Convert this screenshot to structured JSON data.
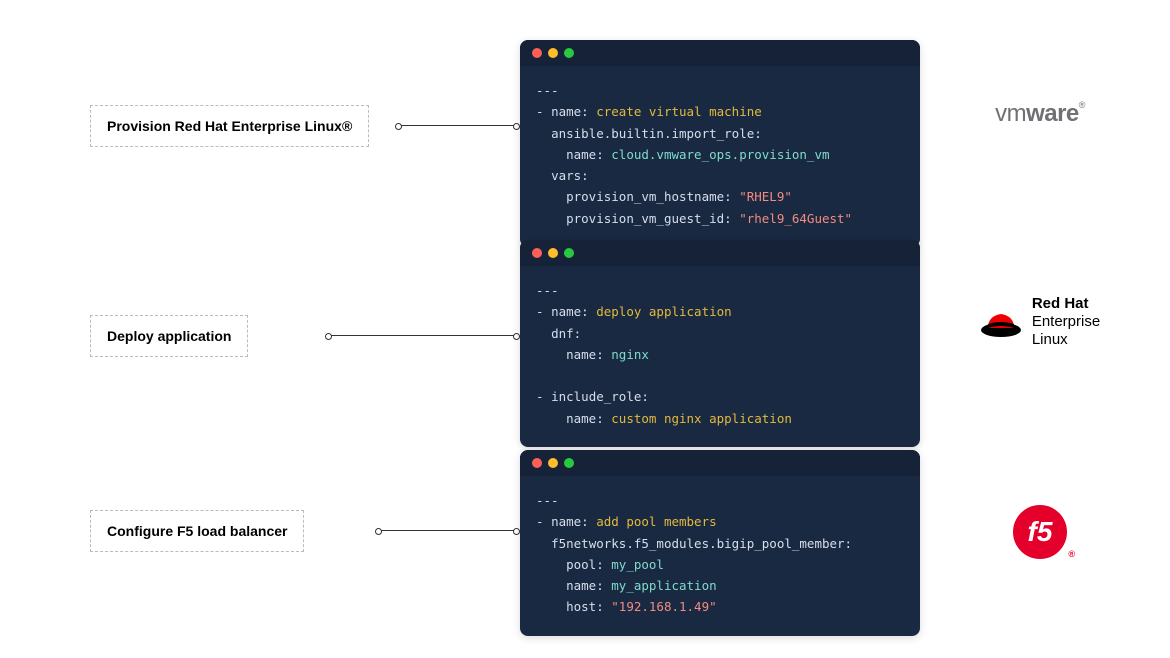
{
  "rows": [
    {
      "label": "Provision Red Hat Enterprise Linux®",
      "logo": "vmware",
      "code": {
        "lines": [
          [
            {
              "c": "t-plain",
              "t": "---"
            }
          ],
          [
            {
              "c": "t-plain",
              "t": "- "
            },
            {
              "c": "t-key",
              "t": "name: "
            },
            {
              "c": "t-name",
              "t": "create virtual machine"
            }
          ],
          [
            {
              "c": "t-plain",
              "t": "  "
            },
            {
              "c": "t-key",
              "t": "ansible.builtin.import_role:"
            }
          ],
          [
            {
              "c": "t-plain",
              "t": "    "
            },
            {
              "c": "t-key",
              "t": "name: "
            },
            {
              "c": "t-val",
              "t": "cloud.vmware_ops.provision_vm"
            }
          ],
          [
            {
              "c": "t-plain",
              "t": "  "
            },
            {
              "c": "t-key",
              "t": "vars:"
            }
          ],
          [
            {
              "c": "t-plain",
              "t": "    "
            },
            {
              "c": "t-key",
              "t": "provision_vm_hostname: "
            },
            {
              "c": "t-str",
              "t": "\"RHEL9\""
            }
          ],
          [
            {
              "c": "t-plain",
              "t": "    "
            },
            {
              "c": "t-key",
              "t": "provision_vm_guest_id: "
            },
            {
              "c": "t-str",
              "t": "\"rhel9_64Guest\""
            }
          ]
        ]
      }
    },
    {
      "label": "Deploy application",
      "logo": "redhat",
      "code": {
        "lines": [
          [
            {
              "c": "t-plain",
              "t": "---"
            }
          ],
          [
            {
              "c": "t-plain",
              "t": "- "
            },
            {
              "c": "t-key",
              "t": "name: "
            },
            {
              "c": "t-name",
              "t": "deploy application"
            }
          ],
          [
            {
              "c": "t-plain",
              "t": "  "
            },
            {
              "c": "t-key",
              "t": "dnf:"
            }
          ],
          [
            {
              "c": "t-plain",
              "t": "    "
            },
            {
              "c": "t-key",
              "t": "name: "
            },
            {
              "c": "t-val",
              "t": "nginx"
            }
          ],
          [
            {
              "c": "t-plain",
              "t": ""
            }
          ],
          [
            {
              "c": "t-plain",
              "t": "- "
            },
            {
              "c": "t-key",
              "t": "include_role:"
            }
          ],
          [
            {
              "c": "t-plain",
              "t": "    "
            },
            {
              "c": "t-key",
              "t": "name: "
            },
            {
              "c": "t-name",
              "t": "custom nginx application"
            }
          ]
        ]
      }
    },
    {
      "label": "Configure F5 load balancer",
      "logo": "f5",
      "code": {
        "lines": [
          [
            {
              "c": "t-plain",
              "t": "---"
            }
          ],
          [
            {
              "c": "t-plain",
              "t": "- "
            },
            {
              "c": "t-key",
              "t": "name: "
            },
            {
              "c": "t-name",
              "t": "add pool members"
            }
          ],
          [
            {
              "c": "t-plain",
              "t": "  "
            },
            {
              "c": "t-key",
              "t": "f5networks.f5_modules.bigip_pool_member:"
            }
          ],
          [
            {
              "c": "t-plain",
              "t": "    "
            },
            {
              "c": "t-key",
              "t": "pool: "
            },
            {
              "c": "t-val",
              "t": "my_pool"
            }
          ],
          [
            {
              "c": "t-plain",
              "t": "    "
            },
            {
              "c": "t-key",
              "t": "name: "
            },
            {
              "c": "t-val",
              "t": "my_application"
            }
          ],
          [
            {
              "c": "t-plain",
              "t": "    "
            },
            {
              "c": "t-key",
              "t": "host: "
            },
            {
              "c": "t-str",
              "t": "\"192.168.1.49\""
            }
          ]
        ]
      }
    }
  ],
  "logos": {
    "vmware": {
      "text1": "vm",
      "text2": "ware",
      "reg": "®"
    },
    "redhat": {
      "line1": "Red Hat",
      "line2": "Enterprise",
      "line3": "Linux"
    },
    "f5": {
      "text": "f5"
    }
  }
}
